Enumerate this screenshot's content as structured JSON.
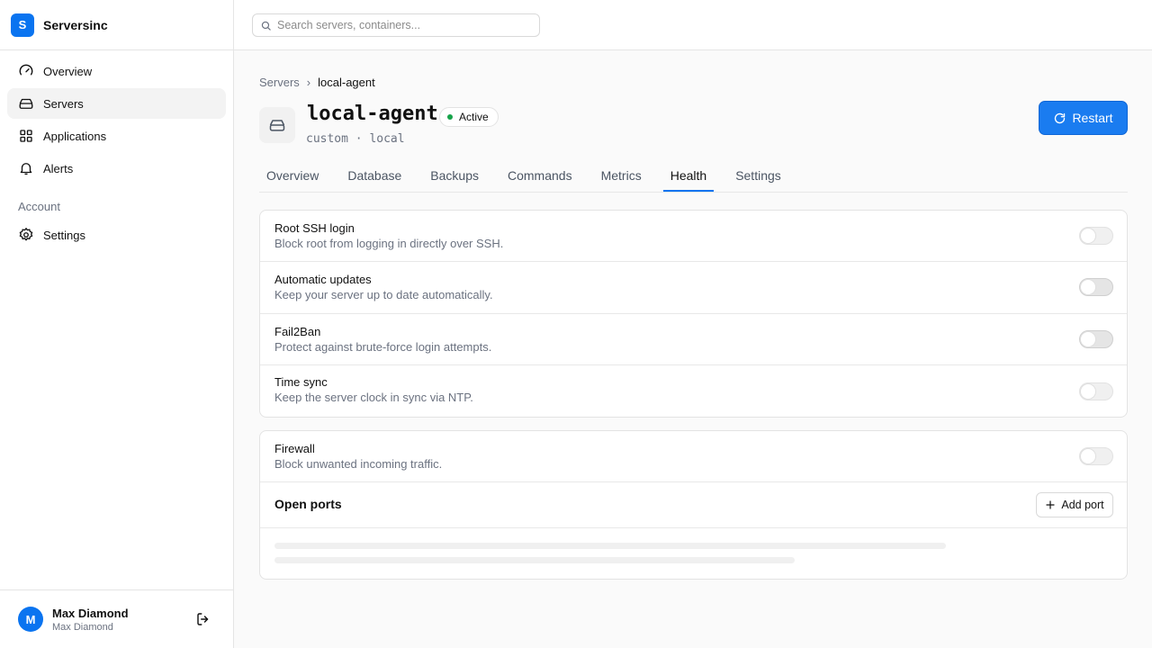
{
  "brand": {
    "logo_letter": "S",
    "name": "Serversinc",
    "accent": "#0a74f0"
  },
  "nav": {
    "items": [
      {
        "label": "Overview",
        "icon": "gauge-icon",
        "active": false
      },
      {
        "label": "Servers",
        "icon": "hard-drive-icon",
        "active": true
      },
      {
        "label": "Applications",
        "icon": "grid-icon",
        "active": false
      },
      {
        "label": "Alerts",
        "icon": "bell-icon",
        "active": false
      }
    ],
    "section_label": "Account",
    "settings_label": "Settings"
  },
  "user": {
    "initial": "M",
    "name": "Max Diamond",
    "subtitle": "Max Diamond"
  },
  "search": {
    "placeholder": "Search servers, containers..."
  },
  "breadcrumb": {
    "parent": "Servers",
    "separator": "›",
    "current": "local-agent"
  },
  "server": {
    "name": "local-agent",
    "status": "Active",
    "status_color": "#16a34a",
    "meta": "custom · local",
    "restart_label": "Restart"
  },
  "tabs": [
    {
      "label": "Overview",
      "active": false
    },
    {
      "label": "Database",
      "active": false
    },
    {
      "label": "Backups",
      "active": false
    },
    {
      "label": "Commands",
      "active": false
    },
    {
      "label": "Metrics",
      "active": false
    },
    {
      "label": "Health",
      "active": true
    },
    {
      "label": "Settings",
      "active": false
    }
  ],
  "health_settings": [
    {
      "title": "Root SSH login",
      "description": "Block root from logging in directly over SSH.",
      "enabled": false
    },
    {
      "title": "Automatic updates",
      "description": "Keep your server up to date automatically.",
      "enabled": false
    },
    {
      "title": "Fail2Ban",
      "description": "Protect against brute-force login attempts.",
      "enabled": false
    },
    {
      "title": "Time sync",
      "description": "Keep the server clock in sync via NTP.",
      "enabled": false
    }
  ],
  "firewall": {
    "title": "Firewall",
    "description": "Block unwanted incoming traffic.",
    "enabled": false,
    "ports_heading": "Open ports",
    "add_port_label": "Add port"
  }
}
